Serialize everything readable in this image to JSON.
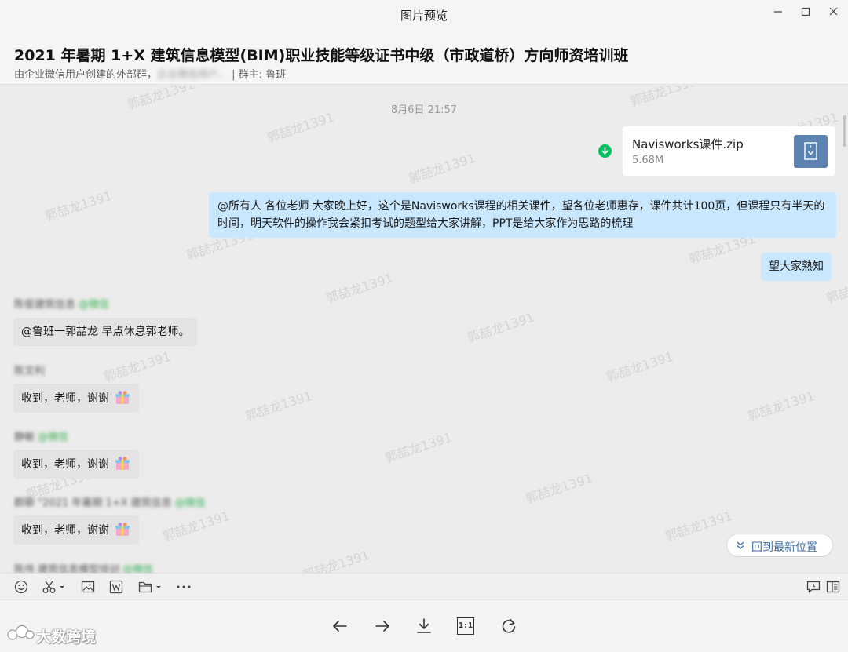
{
  "window": {
    "title": "图片预览"
  },
  "header": {
    "title": "2021 年暑期 1+X 建筑信息模型(BIM)职业技能等级证书中级（市政道桥）方向师资培训班",
    "subtitle_prefix": "由企业微信用户创建的外部群，",
    "subtitle_blurred": "企业微信用户、",
    "subtitle_owner": "| 群主: 鲁班"
  },
  "chat": {
    "watermark_text": "郭喆龙1391",
    "timestamp": "8月6日 21:57",
    "file_message": {
      "name": "Navisworks课件.zip",
      "size": "5.68M"
    },
    "outgoing_1": "@所有人  各位老师  大家晚上好，这个是Navisworks课程的相关课件，望各位老师惠存，课件共计100页，但课程只有半天的时间，明天软件的操作我会紧扣考试的题型给大家讲解，PPT是给大家作为思路的梳理",
    "outgoing_2": "望大家熟知",
    "incoming": [
      {
        "sender": "陈俊建筑信息",
        "tag": "@微信",
        "text": "@鲁班一郭喆龙 早点休息郭老师。",
        "emoji": false
      },
      {
        "sender": "陈文利",
        "tag": "",
        "text": "收到，老师，谢谢",
        "emoji": true
      },
      {
        "sender": "静敏",
        "tag": "@微信",
        "text": "收到，老师，谢谢",
        "emoji": true
      },
      {
        "sender": "群聊 \"2021 年暑期 1+X 建筑信息",
        "tag": "@微信",
        "text": "收到，老师，谢谢",
        "emoji": true
      },
      {
        "sender": "陈伟 建筑信息模型培训",
        "tag": "@微信",
        "text": "",
        "emoji": false
      }
    ],
    "jump_to_latest": "回到最新位置"
  },
  "toolbar": {
    "icons": [
      "emoji-icon",
      "scissors-icon",
      "image-icon",
      "word-icon",
      "folder-icon",
      "more-icon",
      "chat-history-icon",
      "sidebar-icon"
    ]
  },
  "viewer": {
    "buttons": [
      "previous",
      "next",
      "download",
      "actual-size",
      "rotate"
    ],
    "actual_size_label": "1:1",
    "brand": "大数跨境"
  },
  "colors": {
    "accent_green": "#07c160",
    "outgoing_bubble": "#c9e7fe",
    "incoming_bubble": "#e3e3e3",
    "file_icon": "#5c84b3",
    "link_blue": "#3e6ea8"
  }
}
